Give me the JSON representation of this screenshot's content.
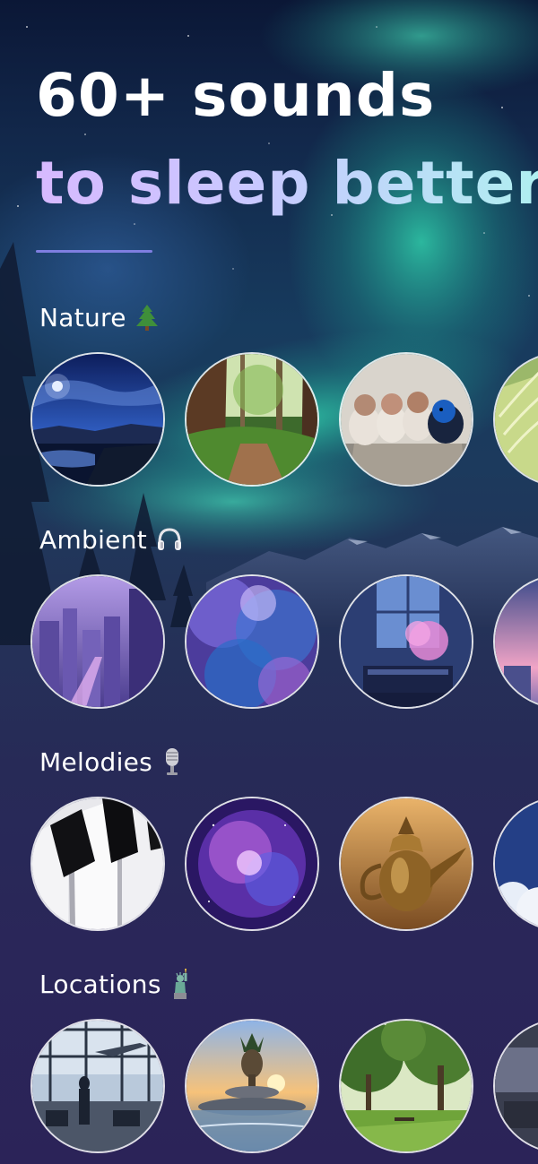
{
  "headline": {
    "line1": "60+ sounds",
    "line2": "to sleep better"
  },
  "sections": [
    {
      "title": "Nature",
      "icon": "evergreen-tree-icon",
      "items": [
        "moonlit-lake-image",
        "forest-path-image",
        "birds-on-stump-image",
        "wheat-field-image"
      ]
    },
    {
      "title": "Ambient",
      "icon": "headphones-icon",
      "items": [
        "purple-city-image",
        "nebula-clouds-image",
        "piano-room-image",
        "city-dusk-image"
      ]
    },
    {
      "title": "Melodies",
      "icon": "microphone-icon",
      "items": [
        "piano-keys-image",
        "purple-galaxy-image",
        "golden-teapot-image",
        "night-sky-clouds-image"
      ]
    },
    {
      "title": "Locations",
      "icon": "statue-of-liberty-icon",
      "items": [
        "airport-terminal-image",
        "pineapple-fountain-image",
        "sunny-park-image",
        "station-interior-image"
      ]
    }
  ],
  "colors": {
    "accent_divider": "#7f7ee0",
    "gradient_start": "#d7b9ff",
    "gradient_end": "#aff0f0",
    "aurora": "#2fd3b0"
  }
}
